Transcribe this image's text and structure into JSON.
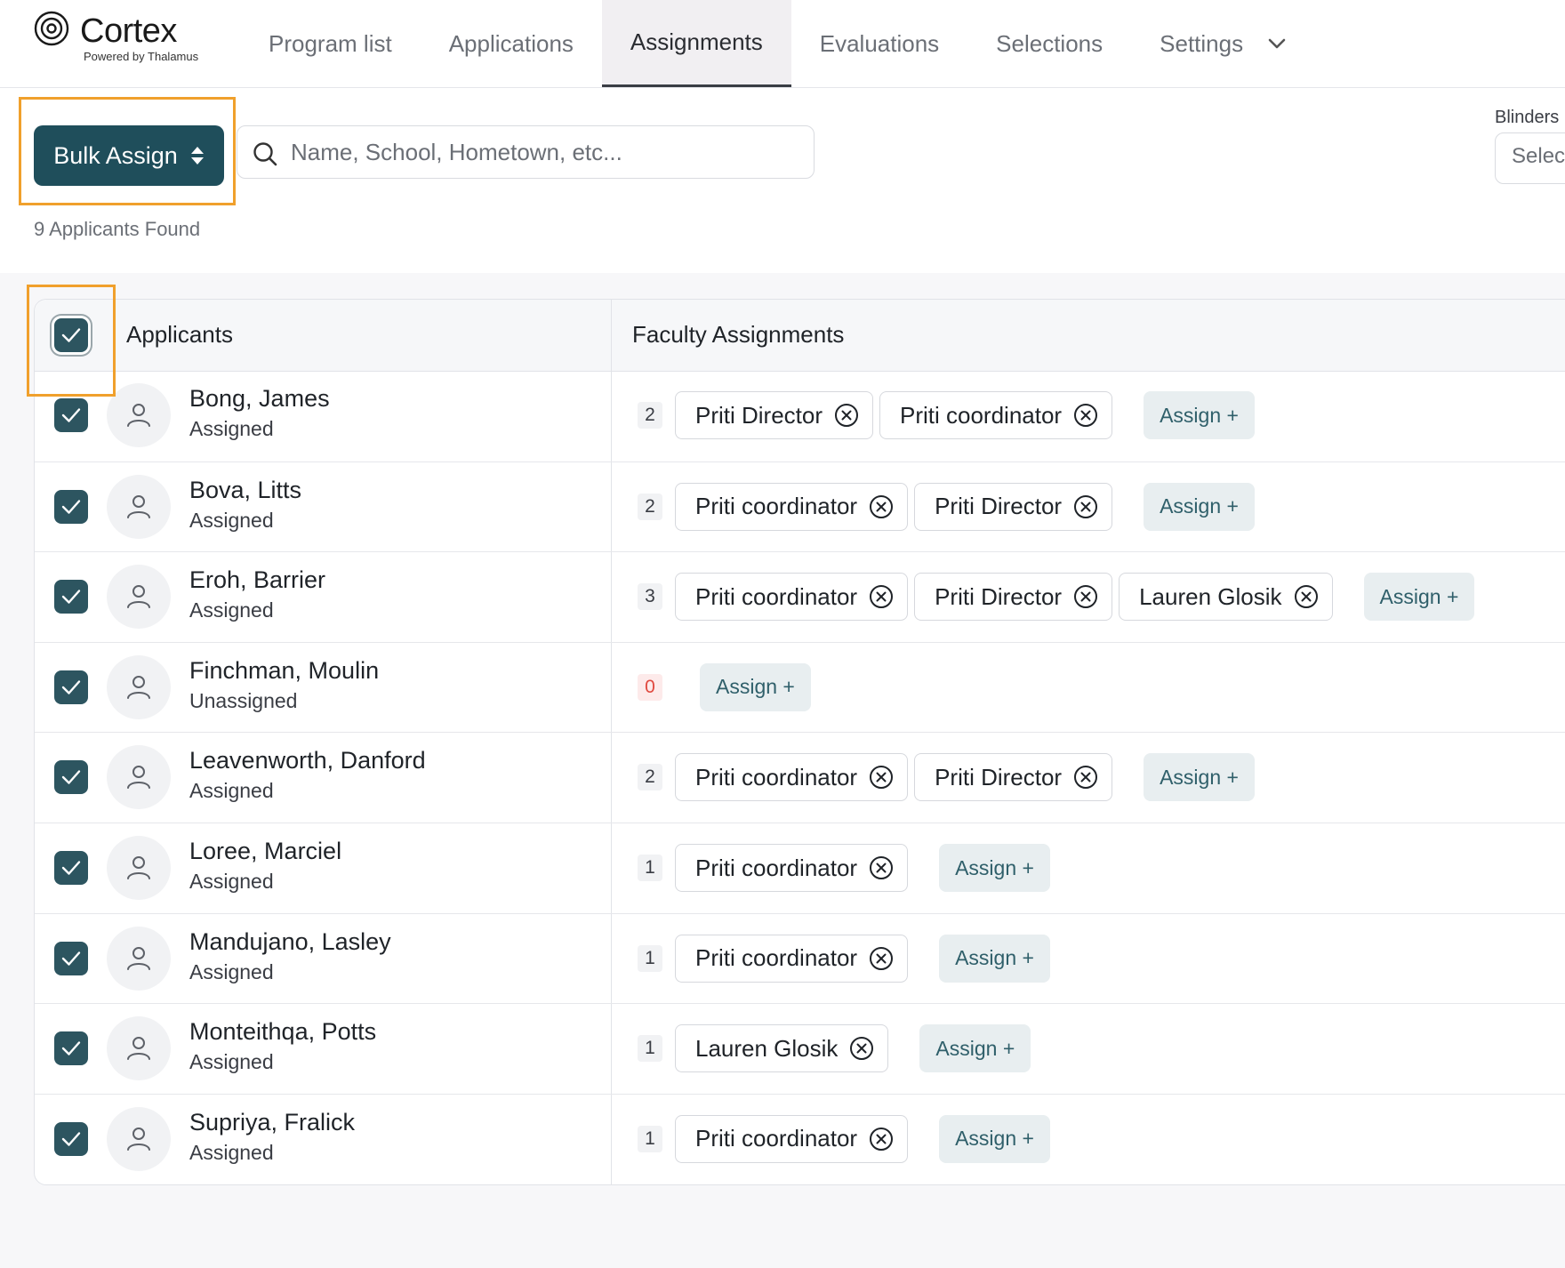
{
  "brand": {
    "name": "Cortex",
    "tagline": "Powered by Thalamus",
    "accent": "#1f4e5b",
    "highlight": "#f0a02c"
  },
  "nav": {
    "tabs": [
      {
        "label": "Program list",
        "active": false
      },
      {
        "label": "Applications",
        "active": false
      },
      {
        "label": "Assignments",
        "active": true
      },
      {
        "label": "Evaluations",
        "active": false
      },
      {
        "label": "Selections",
        "active": false
      },
      {
        "label": "Settings",
        "active": false,
        "icon": "chevron-down-icon"
      }
    ]
  },
  "toolbar": {
    "bulk_assign_label": "Bulk Assign",
    "search_placeholder": "Name, School, Hometown, etc...",
    "results_text": "9 Applicants Found",
    "blinders_label": "Blinders",
    "blinders_value": "Select"
  },
  "table": {
    "headers": {
      "applicants": "Applicants",
      "faculty": "Faculty Assignments"
    },
    "assign_label": "Assign +",
    "rows": [
      {
        "name": "Bong, James",
        "status": "Assigned",
        "count": "2",
        "faculty": [
          "Priti Director",
          "Priti coordinator"
        ]
      },
      {
        "name": "Bova, Litts",
        "status": "Assigned",
        "count": "2",
        "faculty": [
          "Priti coordinator",
          "Priti Director"
        ]
      },
      {
        "name": "Eroh, Barrier",
        "status": "Assigned",
        "count": "3",
        "faculty": [
          "Priti coordinator",
          "Priti Director",
          "Lauren Glosik"
        ]
      },
      {
        "name": "Finchman, Moulin",
        "status": "Unassigned",
        "count": "0",
        "faculty": []
      },
      {
        "name": "Leavenworth, Danford",
        "status": "Assigned",
        "count": "2",
        "faculty": [
          "Priti coordinator",
          "Priti Director"
        ]
      },
      {
        "name": "Loree, Marciel",
        "status": "Assigned",
        "count": "1",
        "faculty": [
          "Priti coordinator"
        ]
      },
      {
        "name": "Mandujano, Lasley",
        "status": "Assigned",
        "count": "1",
        "faculty": [
          "Priti coordinator"
        ]
      },
      {
        "name": "Monteithqa, Potts",
        "status": "Assigned",
        "count": "1",
        "faculty": [
          "Lauren Glosik"
        ]
      },
      {
        "name": "Supriya, Fralick",
        "status": "Assigned",
        "count": "1",
        "faculty": [
          "Priti coordinator"
        ]
      }
    ]
  }
}
